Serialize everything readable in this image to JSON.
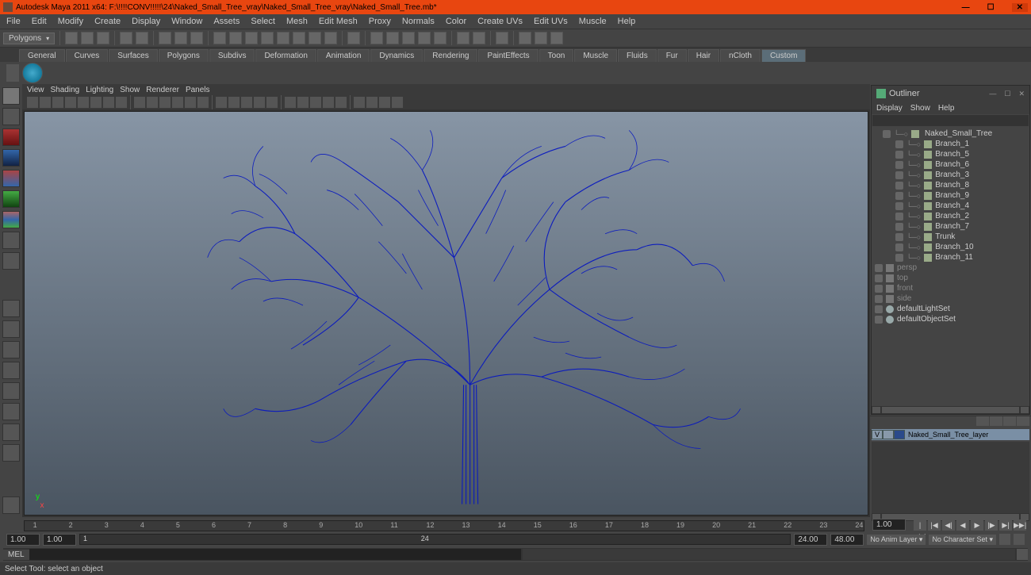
{
  "title": "Autodesk Maya 2011 x64: F:\\!!!!CONV!!!!!\\24\\Naked_Small_Tree_vray\\Naked_Small_Tree_vray\\Naked_Small_Tree.mb*",
  "menu": [
    "File",
    "Edit",
    "Modify",
    "Create",
    "Display",
    "Window",
    "Assets",
    "Select",
    "Mesh",
    "Edit Mesh",
    "Proxy",
    "Normals",
    "Color",
    "Create UVs",
    "Edit UVs",
    "Muscle",
    "Help"
  ],
  "mode_dropdown": "Polygons",
  "shelf_tabs": [
    "General",
    "Curves",
    "Surfaces",
    "Polygons",
    "Subdivs",
    "Deformation",
    "Animation",
    "Dynamics",
    "Rendering",
    "PaintEffects",
    "Toon",
    "Muscle",
    "Fluids",
    "Fur",
    "Hair",
    "nCloth",
    "Custom"
  ],
  "active_shelf_tab": "Custom",
  "viewport_menu": [
    "View",
    "Shading",
    "Lighting",
    "Show",
    "Renderer",
    "Panels"
  ],
  "outliner": {
    "title": "Outliner",
    "menu": [
      "Display",
      "Show",
      "Help"
    ],
    "root": "Naked_Small_Tree",
    "branches": [
      "Branch_1",
      "Branch_5",
      "Branch_6",
      "Branch_3",
      "Branch_8",
      "Branch_9",
      "Branch_4",
      "Branch_2",
      "Branch_7",
      "Trunk",
      "Branch_10",
      "Branch_11"
    ],
    "cameras": [
      "persp",
      "top",
      "front",
      "side"
    ],
    "sets": [
      "defaultLightSet",
      "defaultObjectSet"
    ]
  },
  "layer": {
    "name": "Naked_Small_Tree_layer",
    "vis": "V"
  },
  "timeline": {
    "ticks": [
      "1",
      "2",
      "3",
      "4",
      "5",
      "6",
      "7",
      "8",
      "9",
      "10",
      "11",
      "12",
      "13",
      "14",
      "15",
      "16",
      "17",
      "18",
      "19",
      "20",
      "21",
      "22",
      "23",
      "24"
    ]
  },
  "range": {
    "start1": "1.00",
    "start2": "1.00",
    "cur": "1",
    "end_label": "24",
    "end1": "24.00",
    "end2": "48.00"
  },
  "anim_layer": "No Anim Layer",
  "char_set": "No Character Set",
  "cmd_label": "MEL",
  "status": "Select Tool: select an object"
}
